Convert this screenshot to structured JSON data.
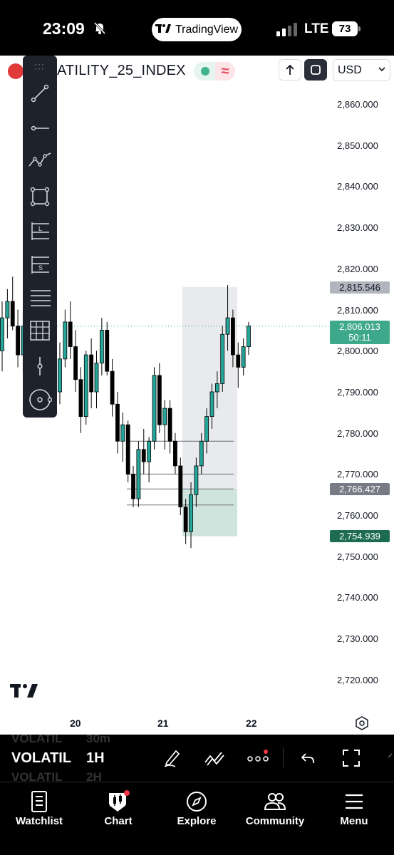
{
  "status_bar": {
    "time": "23:09",
    "app_pill": "TradingView",
    "network": "LTE",
    "battery": "73"
  },
  "header": {
    "symbol": "ATILITY_25_INDEX",
    "currency": "USD"
  },
  "price_axis": {
    "labels": [
      "2,860.000",
      "2,850.000",
      "2,840.000",
      "2,830.000",
      "2,820.000",
      "2,810.000",
      "2,800.000",
      "2,790.000",
      "2,780.000",
      "2,770.000",
      "2,760.000",
      "2,750.000",
      "2,740.000",
      "2,730.000",
      "2,720.000"
    ],
    "tag_high": "2,815.546",
    "tag_current": "2,806.013",
    "tag_countdown": "50:11",
    "tag_mid": "2,766.427",
    "tag_low": "2,754.939"
  },
  "date_axis": {
    "labels": [
      "20",
      "21",
      "22"
    ]
  },
  "controls": {
    "symbol": "VOLATIL",
    "interval": "1H",
    "ghost_above": "VOLATIL",
    "ghost_above_interval": "30m",
    "ghost_below": "VOLATIL",
    "ghost_below_interval": "2H"
  },
  "tabs": [
    {
      "label": "Watchlist",
      "icon": "watchlist-icon"
    },
    {
      "label": "Chart",
      "icon": "chart-icon"
    },
    {
      "label": "Explore",
      "icon": "compass-icon"
    },
    {
      "label": "Community",
      "icon": "community-icon"
    },
    {
      "label": "Menu",
      "icon": "menu-icon"
    }
  ],
  "colors": {
    "up_candle": "#26a69a",
    "down_candle": "#000000",
    "current_tag": "#3ea88a",
    "low_tag": "#1d6b53",
    "high_tag": "#b2b5be",
    "mid_tag": "#787b86"
  },
  "chart_data": {
    "type": "candlestick",
    "ylim": [
      2716,
      2872
    ],
    "ohlc": [
      [
        2800,
        2812,
        2795,
        2808
      ],
      [
        2808,
        2815,
        2803,
        2812
      ],
      [
        2812,
        2818,
        2805,
        2806
      ],
      [
        2806,
        2810,
        2796,
        2799
      ],
      [
        2799,
        2809,
        2795,
        2806
      ],
      [
        2806,
        2818,
        2803,
        2815
      ],
      [
        2815,
        2826,
        2810,
        2820
      ],
      [
        2820,
        2825,
        2805,
        2808
      ],
      [
        2808,
        2812,
        2796,
        2800
      ],
      [
        2800,
        2806,
        2790,
        2796
      ],
      [
        2796,
        2800,
        2786,
        2790
      ],
      [
        2790,
        2802,
        2787,
        2798
      ],
      [
        2798,
        2810,
        2796,
        2807
      ],
      [
        2807,
        2812,
        2798,
        2801
      ],
      [
        2801,
        2805,
        2790,
        2793
      ],
      [
        2793,
        2796,
        2780,
        2784
      ],
      [
        2784,
        2800,
        2782,
        2799
      ],
      [
        2799,
        2803,
        2786,
        2790
      ],
      [
        2790,
        2800,
        2786,
        2797
      ],
      [
        2797,
        2808,
        2794,
        2805
      ],
      [
        2805,
        2807,
        2794,
        2795
      ],
      [
        2795,
        2798,
        2784,
        2787
      ],
      [
        2787,
        2790,
        2775,
        2778
      ],
      [
        2778,
        2785,
        2773,
        2782
      ],
      [
        2782,
        2783,
        2768,
        2770
      ],
      [
        2770,
        2772,
        2762,
        2764
      ],
      [
        2764,
        2778,
        2762,
        2776
      ],
      [
        2776,
        2781,
        2770,
        2773
      ],
      [
        2773,
        2779,
        2768,
        2778
      ],
      [
        2778,
        2796,
        2776,
        2794
      ],
      [
        2794,
        2797,
        2780,
        2782
      ],
      [
        2782,
        2788,
        2776,
        2786
      ],
      [
        2786,
        2788,
        2775,
        2778
      ],
      [
        2778,
        2780,
        2770,
        2772
      ],
      [
        2772,
        2774,
        2760,
        2762
      ],
      [
        2762,
        2764,
        2753,
        2756
      ],
      [
        2756,
        2768,
        2752,
        2765
      ],
      [
        2765,
        2774,
        2762,
        2772
      ],
      [
        2772,
        2780,
        2770,
        2778
      ],
      [
        2778,
        2786,
        2775,
        2784
      ],
      [
        2784,
        2792,
        2781,
        2790
      ],
      [
        2790,
        2795,
        2786,
        2792
      ],
      [
        2792,
        2806,
        2790,
        2804
      ],
      [
        2804,
        2816,
        2800,
        2808
      ],
      [
        2808,
        2810,
        2796,
        2799
      ],
      [
        2799,
        2802,
        2791,
        2796
      ],
      [
        2796,
        2803,
        2794,
        2801
      ],
      [
        2801,
        2807,
        2799,
        2806
      ]
    ]
  }
}
